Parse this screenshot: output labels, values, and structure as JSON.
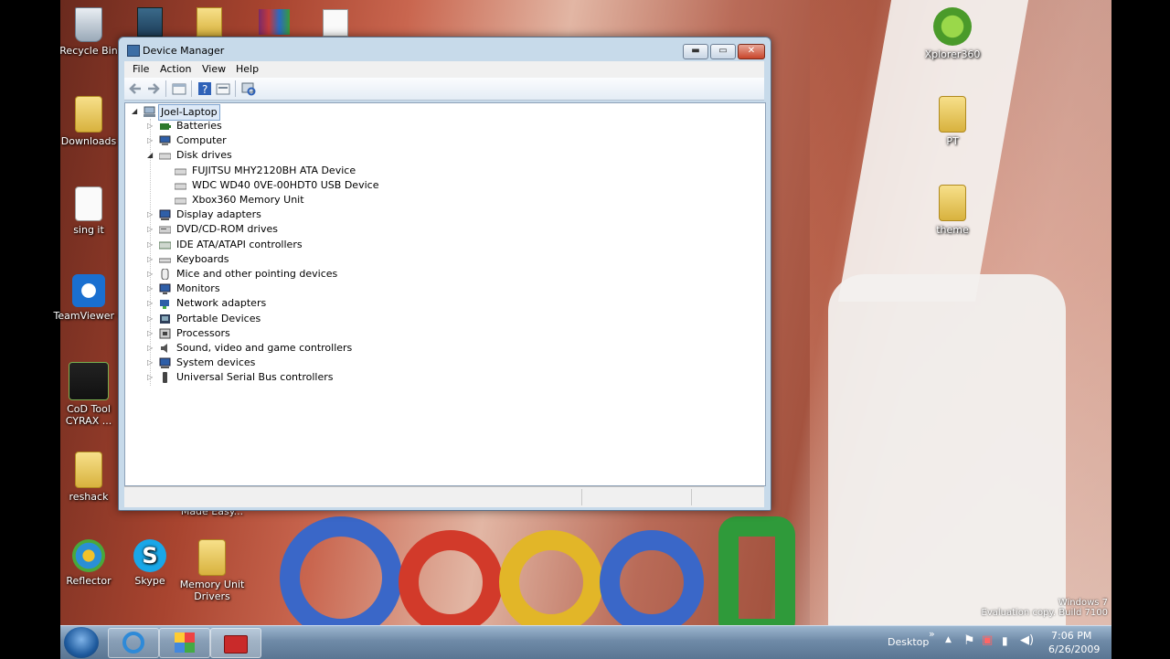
{
  "window": {
    "title": "Device Manager",
    "menu": [
      "File",
      "Action",
      "View",
      "Help"
    ],
    "controls": {
      "minimize": "▬",
      "maximize": "▭",
      "close": "✕"
    }
  },
  "tree": {
    "root": "Joel-Laptop",
    "items": [
      {
        "label": "Batteries",
        "icon": "battery-icon",
        "color": "#2d7a2d"
      },
      {
        "label": "Computer",
        "icon": "computer-icon",
        "color": "#2f5fa8"
      },
      {
        "label": "Disk drives",
        "icon": "disk-drive-icon",
        "color": "#777777",
        "expanded": true,
        "children": [
          "FUJITSU MHY2120BH ATA Device",
          "WDC WD40 0VE-00HDT0 USB Device",
          "Xbox360 Memory Unit"
        ]
      },
      {
        "label": "Display adapters",
        "icon": "display-adapter-icon",
        "color": "#2f5fa8"
      },
      {
        "label": "DVD/CD-ROM drives",
        "icon": "dvd-drive-icon",
        "color": "#777777"
      },
      {
        "label": "IDE ATA/ATAPI controllers",
        "icon": "ide-controller-icon",
        "color": "#5a7a5a"
      },
      {
        "label": "Keyboards",
        "icon": "keyboard-icon",
        "color": "#666666"
      },
      {
        "label": "Mice and other pointing devices",
        "icon": "mouse-icon",
        "color": "#555555"
      },
      {
        "label": "Monitors",
        "icon": "monitor-icon",
        "color": "#2f5fa8"
      },
      {
        "label": "Network adapters",
        "icon": "network-adapter-icon",
        "color": "#2f5fa8"
      },
      {
        "label": "Portable Devices",
        "icon": "portable-device-icon",
        "color": "#2f3f5a"
      },
      {
        "label": "Processors",
        "icon": "processor-icon",
        "color": "#444444"
      },
      {
        "label": "Sound, video and game controllers",
        "icon": "speaker-icon",
        "color": "#555555"
      },
      {
        "label": "System devices",
        "icon": "system-device-icon",
        "color": "#2f5fa8"
      },
      {
        "label": "Universal Serial Bus controllers",
        "icon": "usb-icon",
        "color": "#444444"
      }
    ]
  },
  "desktop": {
    "left_icons": [
      {
        "label": "Recycle Bin",
        "icon": "recycle-bin-icon"
      },
      {
        "label": "Downloads",
        "icon": "folder-icon"
      },
      {
        "label": "sing it",
        "icon": "document-icon"
      },
      {
        "label": "TeamViewer 4",
        "icon": "teamviewer-icon"
      },
      {
        "label": "CoD Tool CYRAX ...",
        "icon": "cod-tool-icon"
      },
      {
        "label": "reshack",
        "icon": "folder-icon"
      }
    ],
    "bottom_icons": [
      {
        "label": "Reflector",
        "icon": "reflector-icon"
      },
      {
        "label": "Skype",
        "icon": "skype-icon"
      },
      {
        "label": "Memory Unit Drivers",
        "icon": "folder-icon"
      }
    ],
    "partial_label": "Made Easy...",
    "right_icons": [
      {
        "label": "Xplorer360",
        "icon": "xbox-icon"
      },
      {
        "label": "PT",
        "icon": "folder-icon"
      },
      {
        "label": "theme",
        "icon": "folder-icon"
      }
    ]
  },
  "taskbar": {
    "desktop_label": "Desktop",
    "time": "7:06 PM",
    "date": "6/26/2009"
  },
  "watermark": {
    "line1": "Windows 7",
    "line2": "Evaluation copy. Build 7100"
  }
}
